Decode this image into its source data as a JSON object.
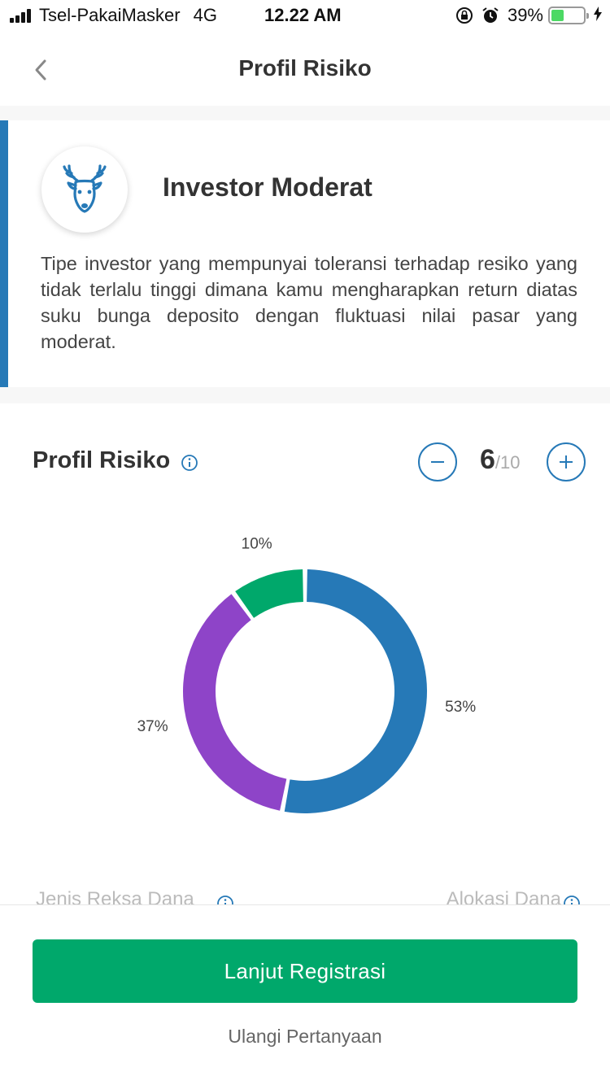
{
  "status_bar": {
    "carrier": "Tsel-PakaiMasker",
    "network": "4G",
    "time": "12.22 AM",
    "battery": "39%",
    "battery_level": 0.39
  },
  "nav": {
    "title": "Profil Risiko",
    "back_icon": "chevron-left-icon"
  },
  "profile": {
    "icon": "deer-icon",
    "title": "Investor Moderat",
    "description": "Tipe investor yang mempunyai toleransi terhadap resiko yang tidak terlalu tinggi dimana kamu mengharapkan return diatas suku bunga deposito dengan fluktuasi nilai pasar yang moderat.",
    "accent_color": "#2679b7"
  },
  "risk": {
    "title": "Profil Risiko",
    "score": "6",
    "max": "/10"
  },
  "chart_data": {
    "type": "pie",
    "values": [
      53,
      37,
      10
    ],
    "labels": [
      "53%",
      "37%",
      "10%"
    ],
    "colors": [
      "#2679b7",
      "#8e44c8",
      "#00a86b"
    ]
  },
  "allocation": {
    "left_label": "Jenis Reksa Dana",
    "right_label": "Alokasi Dana"
  },
  "actions": {
    "primary": "Lanjut Registrasi",
    "secondary": "Ulangi Pertanyaan",
    "primary_color": "#00a86b"
  }
}
